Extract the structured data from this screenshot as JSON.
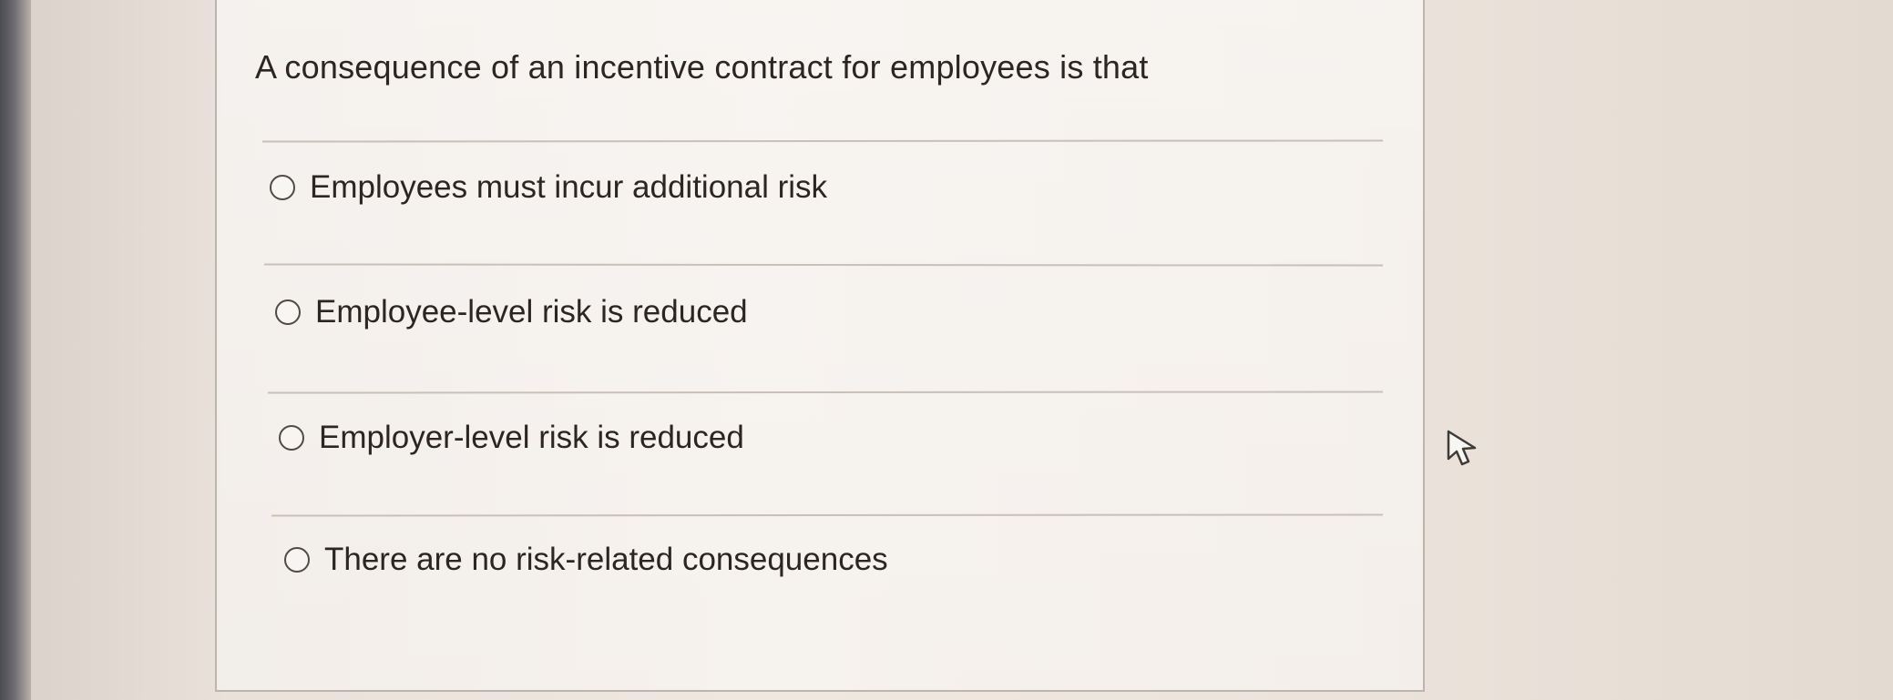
{
  "question": {
    "text": "A consequence of an incentive contract for employees is that"
  },
  "options": [
    {
      "label": "Employees must incur additional risk"
    },
    {
      "label": "Employee-level risk is reduced"
    },
    {
      "label": "Employer-level risk is reduced"
    },
    {
      "label": "There are no risk-related consequences"
    }
  ],
  "icons": {
    "radio": "radio-empty-icon",
    "cursor": "mouse-pointer-icon"
  }
}
